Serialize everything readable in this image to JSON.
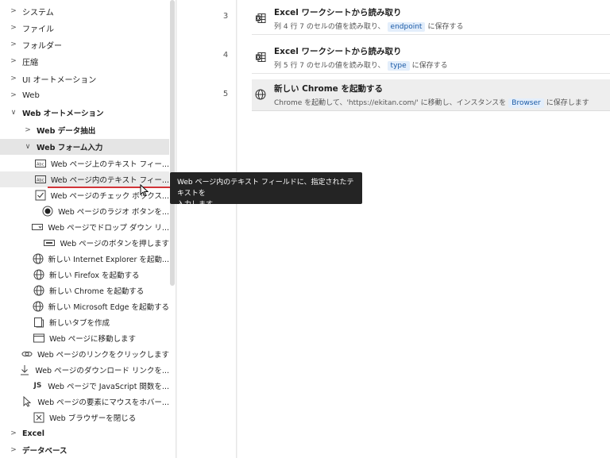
{
  "sidebar": {
    "categories_top": [
      {
        "label": "システム"
      },
      {
        "label": "ファイル"
      },
      {
        "label": "フォルダー"
      },
      {
        "label": "圧縮"
      },
      {
        "label": "UI オートメーション"
      },
      {
        "label": "Web"
      },
      {
        "label": "Web オートメーション"
      }
    ],
    "web_data_extract": "Web データ抽出",
    "web_form_input": "Web フォーム入力",
    "form_actions": [
      {
        "label": "Web ページ上のテキスト フィー..."
      },
      {
        "label": "Web ページ内のテキスト フィー..."
      },
      {
        "label": "Web ページのチェック ボックス..."
      },
      {
        "label": "Web ページのラジオ ボタンを..."
      },
      {
        "label": "Web ページでドロップ ダウン リ..."
      },
      {
        "label": "Web ページのボタンを押します"
      }
    ],
    "web_actions": [
      {
        "label": "新しい Internet Explorer を起動..."
      },
      {
        "label": "新しい Firefox を起動する"
      },
      {
        "label": "新しい Chrome を起動する"
      },
      {
        "label": "新しい Microsoft Edge を起動する"
      },
      {
        "label": "新しいタブを作成"
      },
      {
        "label": "Web ページに移動します"
      },
      {
        "label": "Web ページのリンクをクリックします"
      },
      {
        "label": "Web ページのダウンロード リンクを..."
      },
      {
        "label": "Web ページで JavaScript 関数を..."
      },
      {
        "label": "Web ページの要素にマウスをホバー..."
      },
      {
        "label": "Web ブラウザーを閉じる"
      }
    ],
    "categories_bottom": [
      {
        "label": "Excel"
      },
      {
        "label": "データベース"
      }
    ]
  },
  "flow": {
    "steps": [
      {
        "num": "3",
        "title": "Excel ワークシートから読み取り",
        "desc_pre": "列 4 行 7 のセルの値を読み取り、",
        "token": "endpoint",
        "desc_post": "に保存する",
        "icon": "excel-icon"
      },
      {
        "num": "4",
        "title": "Excel ワークシートから読み取り",
        "desc_pre": "列 5 行 7 のセルの値を読み取り、",
        "token": "type",
        "desc_post": "に保存する",
        "icon": "excel-icon"
      },
      {
        "num": "5",
        "title": "新しい Chrome を起動する",
        "desc_pre": "Chrome を起動して、'https://ekitan.com/' に移動し、インスタンスを",
        "token": "Browser",
        "desc_post": "に保存します",
        "icon": "globe-icon"
      }
    ]
  },
  "tooltip": {
    "line1": "Web ページ内のテキスト フィールドに、指定されたテキストを",
    "line2": "入力します"
  },
  "colors": {
    "accent": "#1a5aa6",
    "token_bg": "#e3eefb",
    "drop_indicator": "#d13438"
  }
}
